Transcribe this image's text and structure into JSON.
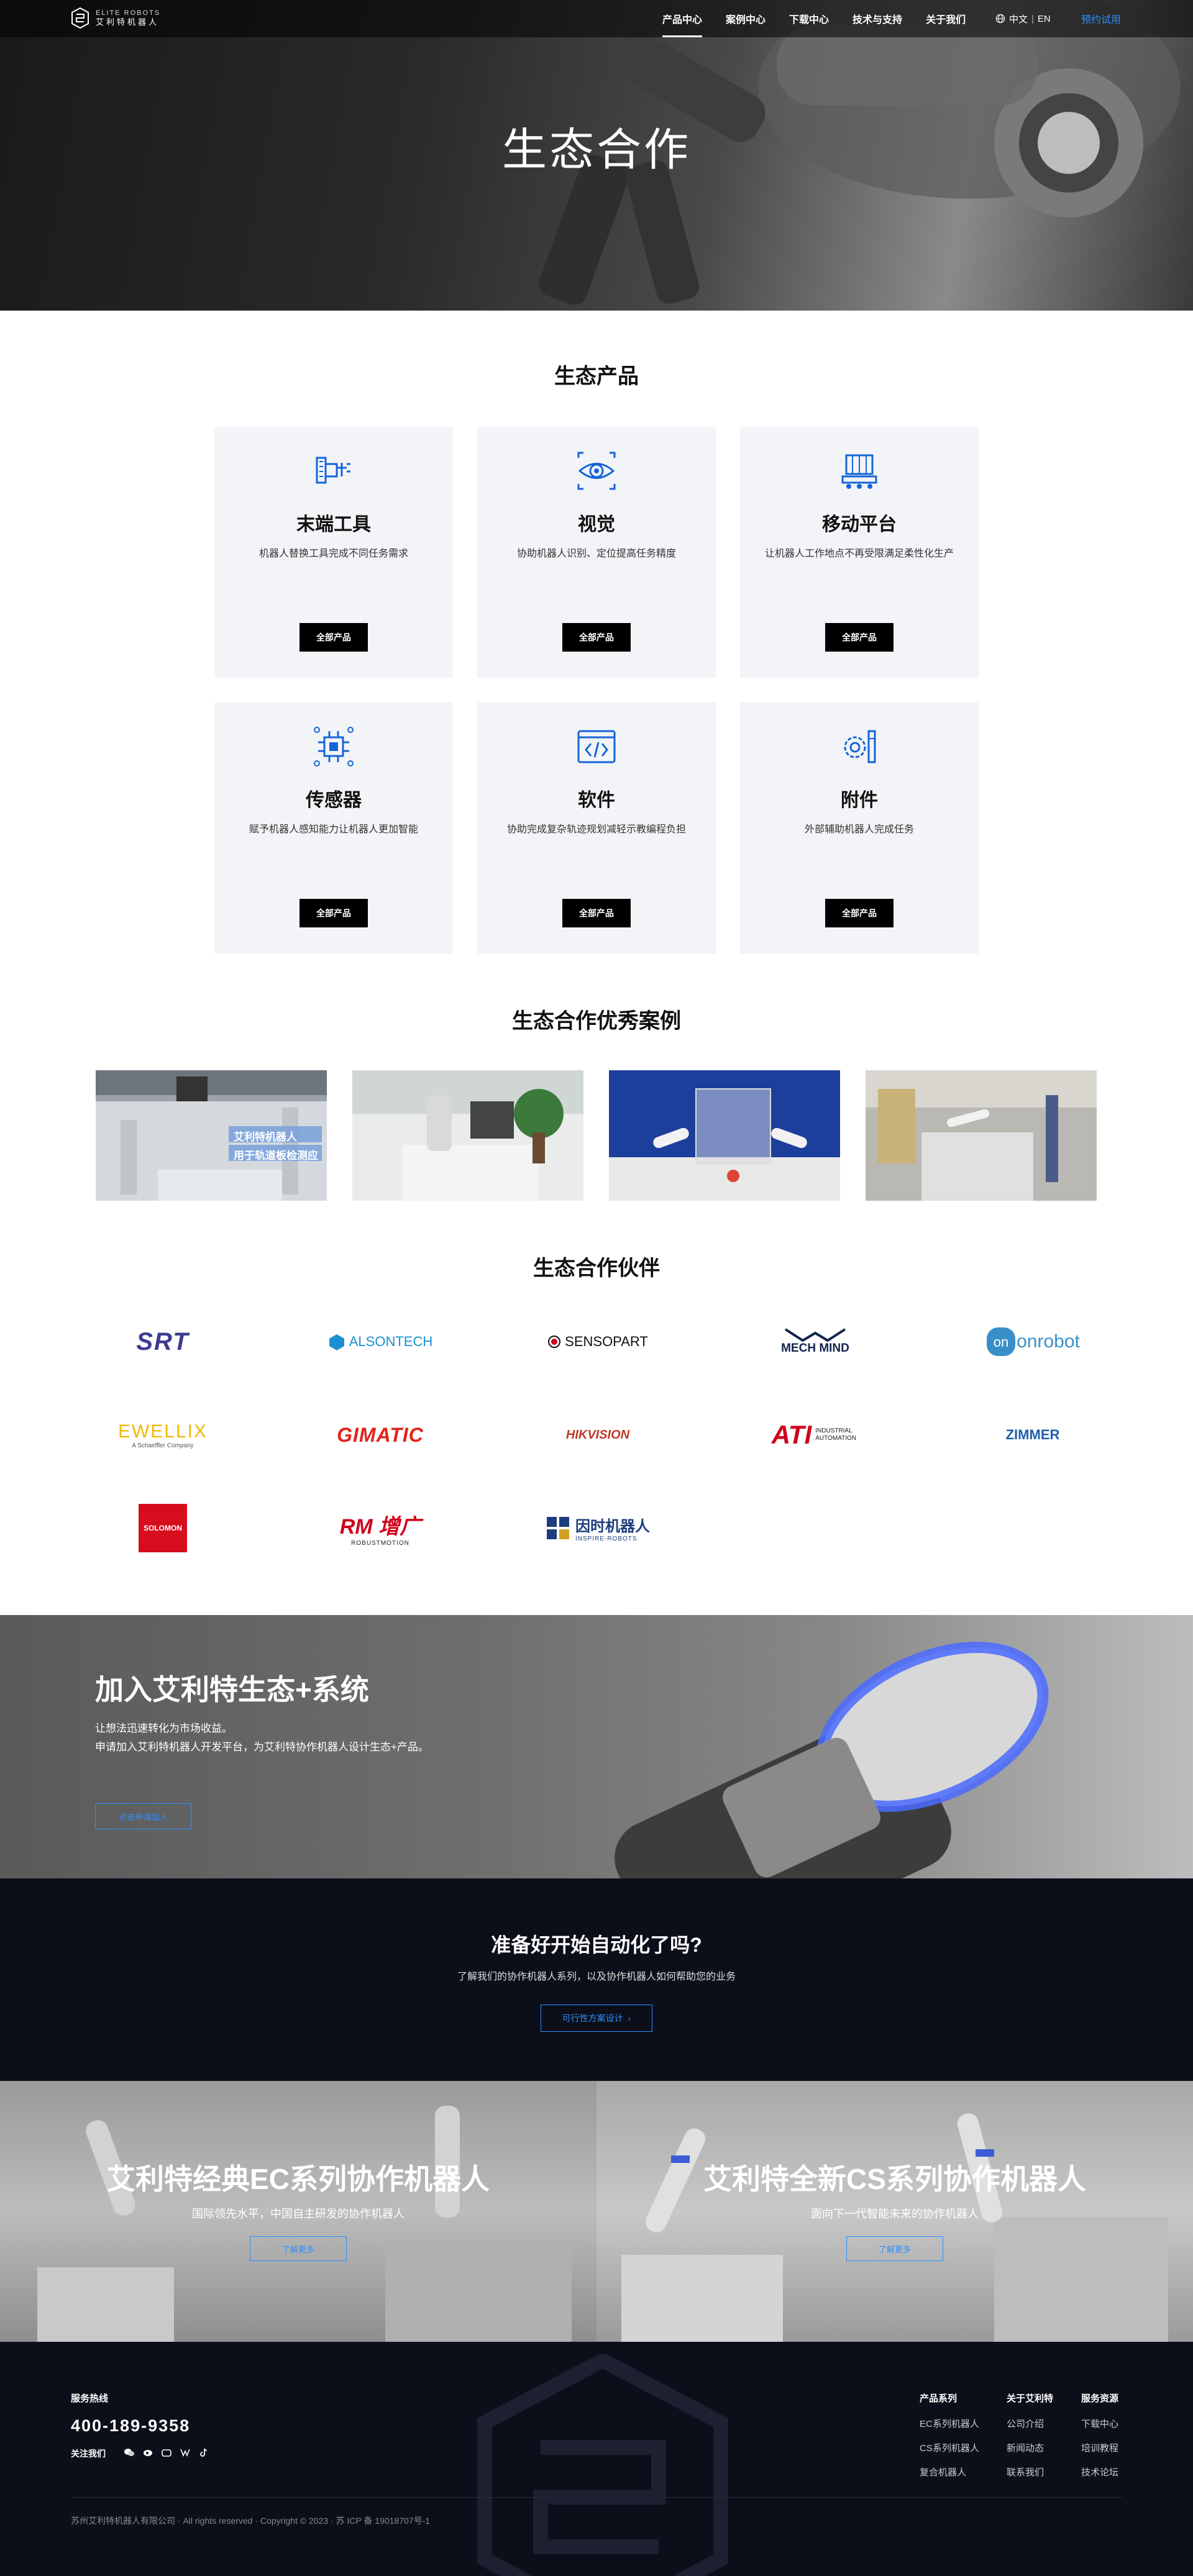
{
  "header": {
    "logo_en": "ELITE ROBOTS",
    "logo_cn": "艾利特机器人",
    "nav": [
      {
        "label": "产品中心",
        "active": true
      },
      {
        "label": "案例中心",
        "active": false
      },
      {
        "label": "下载中心",
        "active": false
      },
      {
        "label": "技术与支持",
        "active": false
      },
      {
        "label": "关于我们",
        "active": false
      }
    ],
    "lang_cn": "中文",
    "lang_sep": "|",
    "lang_en": "EN",
    "trial": "预约试用"
  },
  "hero": {
    "title": "生态合作"
  },
  "products": {
    "title": "生态产品",
    "button_label": "全部产品",
    "items": [
      {
        "title": "末端工具",
        "desc": "机器人替换工具完成不同任务需求",
        "icon": "end-tool-icon"
      },
      {
        "title": "视觉",
        "desc": "协助机器人识别、定位提高任务精度",
        "icon": "vision-icon"
      },
      {
        "title": "移动平台",
        "desc": "让机器人工作地点不再受限满足柔性化生产",
        "icon": "mobile-platform-icon"
      },
      {
        "title": "传感器",
        "desc": "赋予机器人感知能力让机器人更加智能",
        "icon": "sensor-icon"
      },
      {
        "title": "软件",
        "desc": "协助完成复杂轨迹规划减轻示教编程负担",
        "icon": "software-icon"
      },
      {
        "title": "附件",
        "desc": "外部辅助机器人完成任务",
        "icon": "accessory-icon"
      }
    ]
  },
  "cases": {
    "title": "生态合作优秀案例",
    "items": [
      {
        "overlay_line1": "艾利特机器人",
        "overlay_line2": "用于轨道板检测应"
      },
      {
        "overlay_line1": "",
        "overlay_line2": ""
      },
      {
        "overlay_line1": "",
        "overlay_line2": ""
      },
      {
        "overlay_line1": "",
        "overlay_line2": ""
      }
    ]
  },
  "partners": {
    "title": "生态合作伙伴",
    "items": [
      {
        "name": "SRT",
        "color": "#3b3c8f"
      },
      {
        "name": "ALSONTECH",
        "color": "#1b8fd0"
      },
      {
        "name": "SENSOPART",
        "color": "#111111"
      },
      {
        "name": "MECH MIND",
        "color": "#12234f"
      },
      {
        "name": "onrobot",
        "color": "#3b8fc9"
      },
      {
        "name": "EWELLIX",
        "color": "#f0b800",
        "sub": "A Schaeffler Company"
      },
      {
        "name": "GIMATIC",
        "color": "#e2231a"
      },
      {
        "name": "HIKVISION",
        "color": "#c0392b"
      },
      {
        "name": "ATI",
        "color": "#d0021b",
        "sub": "INDUSTRIAL AUTOMATION"
      },
      {
        "name": "ZIMMER",
        "color": "#1f5fa8"
      },
      {
        "name": "SOLOMON",
        "color": "#ffffff",
        "bg": "#d60d1d"
      },
      {
        "name": "RM 增广",
        "color": "#d0021b",
        "sub": "ROBUSTMOTION"
      },
      {
        "name": "因时机器人",
        "color": "#1d3d7a",
        "sub": "INSPIRE-ROBOTS"
      }
    ]
  },
  "join": {
    "title": "加入艾利特生态+系统",
    "line1": "让想法迅速转化为市场收益。",
    "line2": "申请加入艾利特机器人开发平台，为艾利特协作机器人设计生态+产品。",
    "button": "点击申请加入"
  },
  "ready": {
    "title": "准备好开始自动化了吗?",
    "desc": "了解我们的协作机器人系列，以及协作机器人如何帮助您的业务",
    "button": "可行性方案设计",
    "button_arrow": "›"
  },
  "series": [
    {
      "title": "艾利特经典EC系列协作机器人",
      "desc": "国际领先水平，中国自主研发的协作机器人",
      "button": "了解更多"
    },
    {
      "title": "艾利特全新CS系列协作机器人",
      "desc": "面向下一代智能未来的协作机器人",
      "button": "了解更多"
    }
  ],
  "footer": {
    "hotline_label": "服务热线",
    "phone": "400-189-9358",
    "follow_label": "关注我们",
    "cols": [
      {
        "title": "产品系列",
        "links": [
          "EC系列机器人",
          "CS系列机器人",
          "复合机器人"
        ]
      },
      {
        "title": "关于艾利特",
        "links": [
          "公司介绍",
          "新闻动态",
          "联系我们"
        ]
      },
      {
        "title": "服务资源",
        "links": [
          "下载中心",
          "培训教程",
          "技术论坛"
        ]
      }
    ],
    "copyright": "苏州艾利特机器人有限公司 · All rights reserved · Copyright © 2023 · 苏 ICP 备 19018707号-1"
  }
}
